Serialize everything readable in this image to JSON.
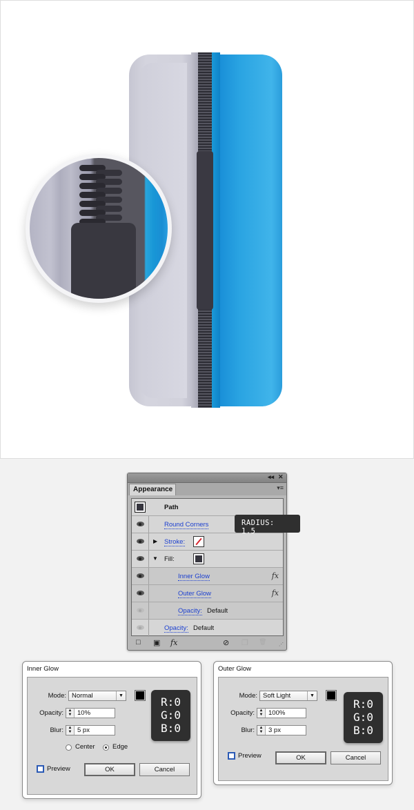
{
  "illustration": {
    "name": "zipper-case",
    "colors": {
      "left_body": "#d2d2dc",
      "right_body": "#2aa4e2",
      "zipper": "#3a3942",
      "puller": "#3a3942"
    },
    "magnifier_teeth": [
      1,
      2,
      3,
      4,
      5,
      6,
      7,
      8,
      9,
      10,
      11,
      12,
      13
    ]
  },
  "appearance_panel": {
    "title": "Appearance",
    "titlebar_icons": {
      "collapse": "◂◂",
      "close": "✕"
    },
    "menu_icon": "▾≡",
    "header": {
      "label": "Path"
    },
    "rows": [
      {
        "kind": "effect",
        "label": "Round Corners",
        "visible": true
      },
      {
        "kind": "stroke",
        "label": "Stroke:",
        "visible": true,
        "expanded": false
      },
      {
        "kind": "fill",
        "label": "Fill:",
        "visible": true,
        "expanded": true
      },
      {
        "kind": "sub-effect",
        "label": "Inner Glow",
        "visible": true,
        "fx": "fx"
      },
      {
        "kind": "sub-effect",
        "label": "Outer Glow",
        "visible": true,
        "fx": "fx"
      },
      {
        "kind": "sub-opacity",
        "label": "Opacity:",
        "value": "Default",
        "visible": false
      },
      {
        "kind": "opacity",
        "label": "Opacity:",
        "value": "Default",
        "visible": false
      }
    ],
    "toolbar": {
      "new_stroke": "□",
      "new_fill": "▣",
      "fx_menu": "fx",
      "clear": "⊘",
      "duplicate": "❐",
      "delete": "🗑"
    }
  },
  "tooltip": {
    "text": "RADIUS: 1.5"
  },
  "inner_glow": {
    "title": "Inner Glow",
    "mode_label": "Mode:",
    "mode": "Normal",
    "color": "#000000",
    "opacity_label": "Opacity:",
    "opacity": "10%",
    "blur_label": "Blur:",
    "blur": "5 px",
    "rgb": {
      "r": "R:0",
      "g": "G:0",
      "b": "B:0"
    },
    "center_label": "Center",
    "edge_label": "Edge",
    "selected": "Edge",
    "preview_label": "Preview",
    "preview_checked": false,
    "ok_label": "OK",
    "cancel_label": "Cancel"
  },
  "outer_glow": {
    "title": "Outer Glow",
    "mode_label": "Mode:",
    "mode": "Soft Light",
    "color": "#000000",
    "opacity_label": "Opacity:",
    "opacity": "100%",
    "blur_label": "Blur:",
    "blur": "3 px",
    "rgb": {
      "r": "R:0",
      "g": "G:0",
      "b": "B:0"
    },
    "preview_label": "Preview",
    "preview_checked": false,
    "ok_label": "OK",
    "cancel_label": "Cancel"
  }
}
